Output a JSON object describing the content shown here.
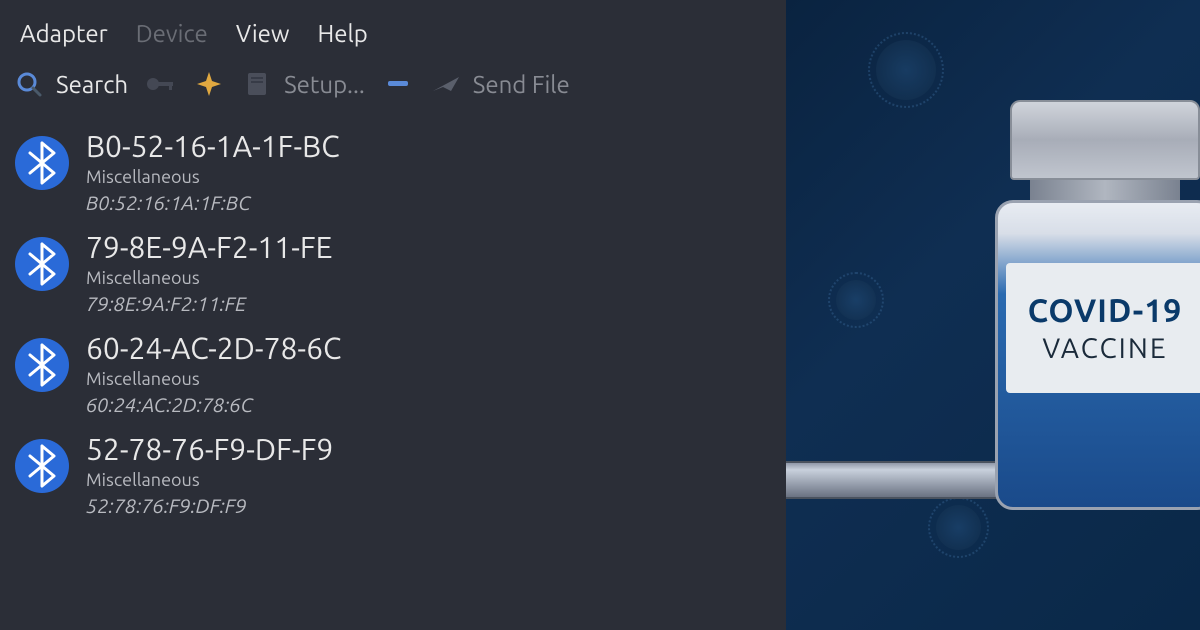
{
  "menu": {
    "adapter": "Adapter",
    "device": "Device",
    "view": "View",
    "help": "Help"
  },
  "toolbar": {
    "search": "Search",
    "setup": "Setup...",
    "send_file": "Send File"
  },
  "devices": [
    {
      "name": "B0-52-16-1A-1F-BC",
      "type": "Miscellaneous",
      "mac": "B0:52:16:1A:1F:BC"
    },
    {
      "name": "79-8E-9A-F2-11-FE",
      "type": "Miscellaneous",
      "mac": "79:8E:9A:F2:11:FE"
    },
    {
      "name": "60-24-AC-2D-78-6C",
      "type": "Miscellaneous",
      "mac": "60:24:AC:2D:78:6C"
    },
    {
      "name": "52-78-76-F9-DF-F9",
      "type": "Miscellaneous",
      "mac": "52:78:76:F9:DF:F9"
    }
  ],
  "illustration": {
    "label_title": "COVID-19",
    "label_sub": "VACCINE"
  }
}
